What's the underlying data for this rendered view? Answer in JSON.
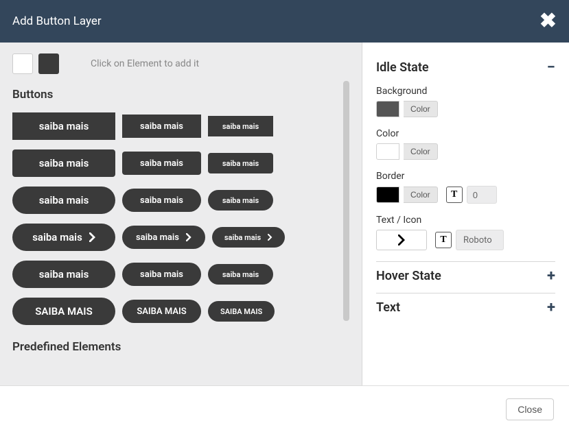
{
  "header": {
    "title": "Add Button Layer"
  },
  "left": {
    "hint": "Click on Element to add it",
    "sections": {
      "buttons": "Buttons",
      "predefined": "Predefined Elements"
    },
    "sample_label": "saiba mais",
    "sample_label_upper": "SAIBA MAIS"
  },
  "right": {
    "section_idle": "Idle State",
    "section_hover": "Hover State",
    "section_text": "Text",
    "labels": {
      "background": "Background",
      "color": "Color",
      "border": "Border",
      "text_icon": "Text / Icon"
    },
    "color_btn": "Color",
    "border_value": "0",
    "font": "Roboto"
  },
  "footer": {
    "close": "Close"
  }
}
